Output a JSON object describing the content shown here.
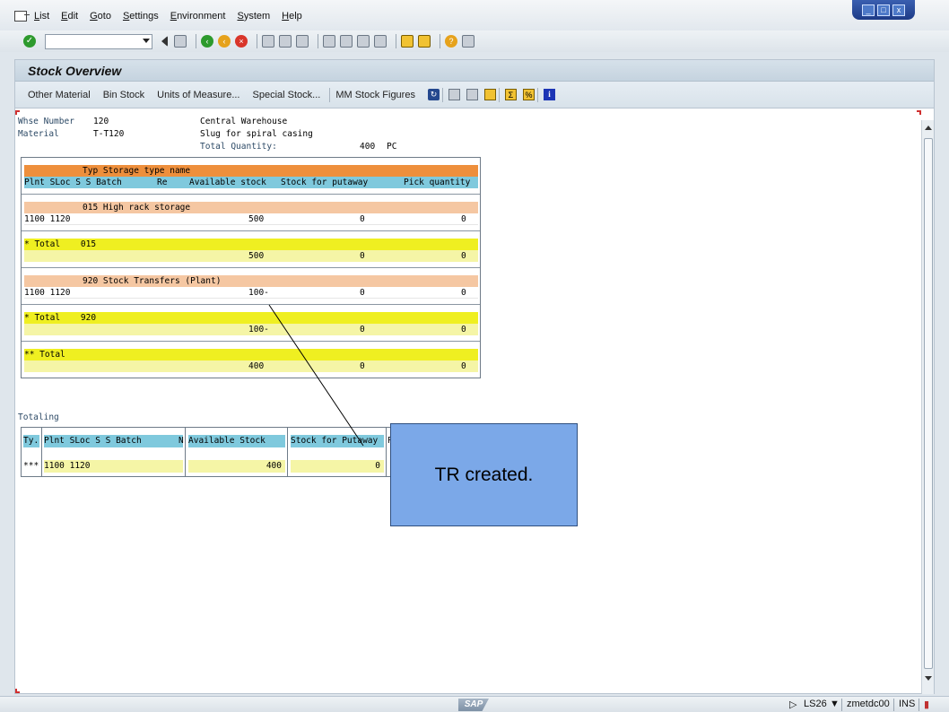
{
  "menubar": {
    "items": [
      "List",
      "Edit",
      "Goto",
      "Settings",
      "Environment",
      "System",
      "Help"
    ]
  },
  "window_buttons": {
    "minimize": "_",
    "maximize": "□",
    "close": "x"
  },
  "command_field": {
    "value": ""
  },
  "screen": {
    "title": "Stock Overview"
  },
  "app_toolbar": {
    "buttons": [
      "Other Material",
      "Bin Stock",
      "Units of Measure...",
      "Special Stock...",
      "MM Stock Figures"
    ]
  },
  "header": {
    "whse_label": "Whse Number",
    "whse_value": "120",
    "whse_desc": "Central Warehouse",
    "material_label": "Material",
    "material_value": "T-T120",
    "material_desc": "Slug for spiral casing",
    "total_qty_label": "Total Quantity:",
    "total_qty_value": "400",
    "total_qty_unit": "PC"
  },
  "stock_grid": {
    "header1": "Typ Storage type name",
    "header2_cols": [
      "Plnt SLoc S S Batch",
      "Re",
      "Available stock",
      "Stock for putaway",
      "Pick quantity"
    ],
    "groups": [
      {
        "type_line": "015 High rack storage",
        "detail": {
          "plant_sloc": "1100 1120",
          "available": "500",
          "putaway": "0",
          "pick": "0"
        },
        "total_label": "* Total    015",
        "total": {
          "available": "500",
          "putaway": "0",
          "pick": "0"
        }
      },
      {
        "type_line": "920 Stock Transfers (Plant)",
        "detail": {
          "plant_sloc": "1100 1120",
          "available": "100-",
          "putaway": "0",
          "pick": "0"
        },
        "total_label": "* Total    920",
        "total": {
          "available": "100-",
          "putaway": "0",
          "pick": "0"
        }
      }
    ],
    "grand_total_label": "** Total",
    "grand_total": {
      "available": "400",
      "putaway": "0",
      "pick": "0"
    }
  },
  "totaling": {
    "label": "Totaling",
    "columns": [
      "Ty.",
      "Plnt SLoc S S Batch",
      "N",
      "Available Stock",
      "Stock for Putaway",
      "P"
    ],
    "row": {
      "ty": "***",
      "plant_sloc": "1100 1120",
      "available": "400",
      "putaway": "0"
    }
  },
  "callout": {
    "text": "TR created."
  },
  "statusbar": {
    "logo": "SAP",
    "system": "LS26",
    "server": "zmetdc00",
    "mode": "INS"
  }
}
